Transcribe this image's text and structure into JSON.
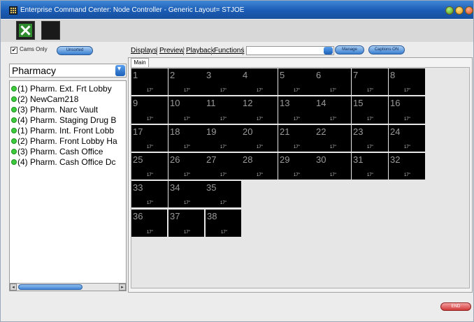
{
  "window": {
    "title": "Enterprise Command Center: Node Controller - Generic     Layout= STJOE",
    "title_color": "#ffffff",
    "titlebar_color": "#1a5cb4"
  },
  "toolbar": {
    "close_icon": "green-x-icon",
    "blank_button": "blank-tile-icon"
  },
  "left_panel": {
    "cams_only_label": "Cams Only",
    "cams_only_checked": true,
    "sort_button": "Unsorted",
    "location": "Pharmacy",
    "cameras": [
      "(1) Pharm. Ext. Frt Lobby",
      "(2) NewCam218",
      "(3) Pharm. Narc Vault",
      "(4) Pharm. Staging Drug B",
      "(1) Pharm. Int. Front Lobb",
      "(2) Pharm. Front Lobby Ha",
      "(3) Pharm. Cash Office",
      "(4) Pharm. Cash Office Dc"
    ],
    "status_color": "#3bcb3b"
  },
  "tabs": {
    "displays": "Displays",
    "preview": "Preview",
    "playback": "Playback",
    "functions": "Functions"
  },
  "top_buttons": {
    "manage": "Manage",
    "captions": "Captions ON"
  },
  "subtab": "Main",
  "tile_size_label": "17\"",
  "tiles": [
    "1",
    "2",
    "3",
    "4",
    "5",
    "6",
    "7",
    "8",
    "9",
    "10",
    "11",
    "12",
    "13",
    "14",
    "15",
    "16",
    "17",
    "18",
    "19",
    "20",
    "21",
    "22",
    "23",
    "24",
    "25",
    "26",
    "27",
    "28",
    "29",
    "30",
    "31",
    "32",
    "33",
    "34",
    "35",
    "36",
    "37",
    "38"
  ],
  "end_button": "END",
  "accent_blue": "#3a7fd0",
  "accent_red": "#d13a3a"
}
